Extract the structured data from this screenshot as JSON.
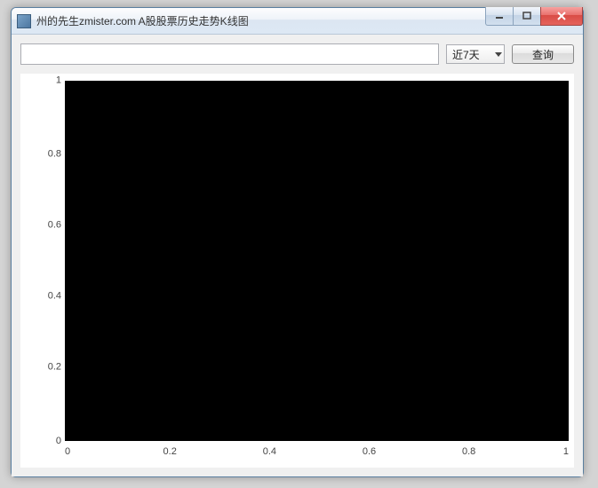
{
  "window": {
    "title": "州的先生zmister.com A股股票历史走势K线图"
  },
  "toolbar": {
    "stock_input_value": "",
    "stock_input_placeholder": "",
    "period_selected": "近7天",
    "query_label": "查询"
  },
  "chart_data": {
    "type": "line",
    "series": [],
    "title": "",
    "xlabel": "",
    "ylabel": "",
    "xlim": [
      0,
      1
    ],
    "ylim": [
      0,
      1
    ],
    "x_ticks": [
      0,
      0.2,
      0.4,
      0.6,
      0.8,
      1
    ],
    "y_ticks": [
      0,
      0.2,
      0.4,
      0.6,
      0.8,
      1
    ],
    "x_tick_labels": [
      "0",
      "0.2",
      "0.4",
      "0.6",
      "0.8",
      "1"
    ],
    "y_tick_labels": [
      "0",
      "0.2",
      "0.4",
      "0.6",
      "0.8",
      "1"
    ],
    "background": "#000000"
  }
}
